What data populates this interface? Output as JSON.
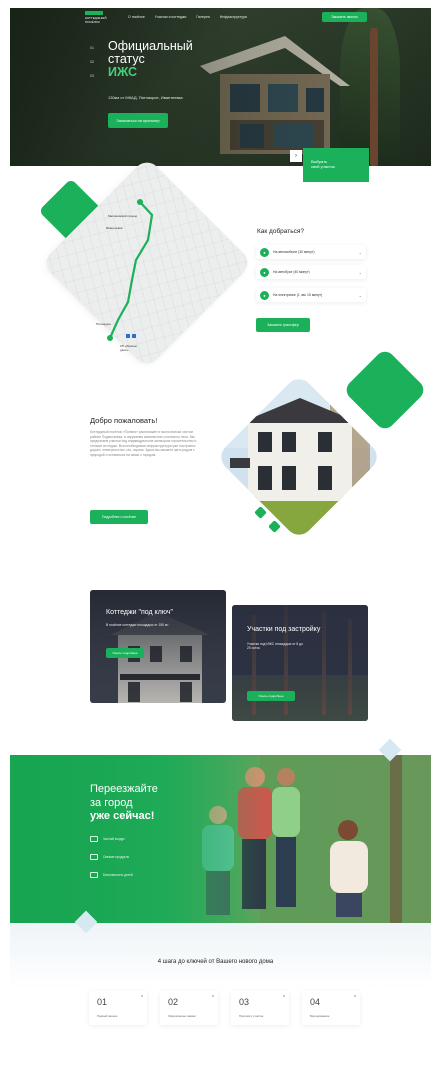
{
  "header": {
    "logo_text": "КОТТЕДЖНЫЙ ПОСЁЛОК",
    "nav": [
      "О посёлке",
      "Участки и коттеджи",
      "Галерея",
      "Инфраструктура"
    ],
    "call_button": "Заказать звонок"
  },
  "hero": {
    "title_line1": "Официальный",
    "title_line2": "статус",
    "title_accent": "ИЖС",
    "subtitle": "130км от МКАД. Пятницкое, Ивантеевка",
    "button": "Записаться на просмотр",
    "side_numbers": [
      "01",
      "02",
      "03"
    ],
    "arrow": "›",
    "choose_label_1": "Выбрать",
    "choose_label_2": "свой участок"
  },
  "map": {
    "labels": [
      "Малиновский проезд",
      "Ивантеевка",
      "Пятницкое",
      "КП «Лесные дали»"
    ],
    "how_title": "Как добраться?",
    "options": [
      {
        "icon": "car-icon",
        "label": "На автомобиле  (30 минут)"
      },
      {
        "icon": "bus-icon",
        "label": "На автобусе  (40 минут)"
      },
      {
        "icon": "train-icon",
        "label": "На электричке  (1 час 15 минут)"
      }
    ],
    "route_button": "Заказать трансфер"
  },
  "welcome": {
    "title": "Добро пожаловать!",
    "text": "Коттеджный посёлок «Поляна» расположен в экологически чистом районе Подмосковья, в окружении живописного соснового леса. Мы предлагаем участки под индивидуальное жилищное строительство и готовые коттеджи. Вся необходимая инфраструктура уже построена: дороги, электричество, газ, охрана. Здесь вы сможете жить рядом с природой и оставаться на связи с городом.",
    "button": "Подробнее о посёлке"
  },
  "cards": [
    {
      "title": "Коттеджи \"под ключ\"",
      "text": "В посёлке коттеджи площадью от 150 м²",
      "button": "Узнать подробнее"
    },
    {
      "title": "Участки под застройку",
      "text": "Участки под ИЖС площадью от 8 до 20 соток",
      "button": "Узнать подробнее"
    }
  ],
  "banner": {
    "title_line1": "Переезжайте",
    "title_line2": "за город",
    "title_bold": "уже сейчас!",
    "features": [
      "Чистый воздух",
      "Свежие продукты",
      "Безопасность детей"
    ]
  },
  "steps": {
    "title": "4 шага до ключей от Вашего нового дома",
    "items": [
      {
        "num": "01",
        "caption": "Первый звонок"
      },
      {
        "num": "02",
        "caption": "Оформление заявки"
      },
      {
        "num": "03",
        "caption": "Просмотр участка"
      },
      {
        "num": "04",
        "caption": "Бронирование"
      }
    ]
  },
  "colors": {
    "accent": "#1bb15b",
    "dark": "#2d2d3a"
  }
}
